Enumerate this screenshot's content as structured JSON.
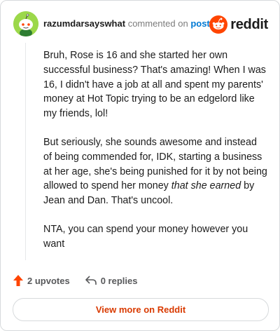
{
  "header": {
    "username": "razumdarsayswhat",
    "commented_text": "commented on",
    "post_link": "post",
    "logo_text": "reddit"
  },
  "comment": {
    "p1": "Bruh, Rose is 16 and she started her own successful business? That's amazing! When I was 16, I didn't have a job at all and spent my parents' money at Hot Topic trying to be an edgelord like my friends, lol!",
    "p2_a": "But seriously, she sounds awesome and instead of being commended for, IDK, starting a business at her age, she's being punished for it by not being allowed to spend her money ",
    "p2_em1": "that she earned",
    "p2_b": " by Jean and Dan. That's uncool.",
    "p3": "NTA, you can spend your money however you want"
  },
  "actions": {
    "upvotes": "2 upvotes",
    "replies": "0 replies"
  },
  "cta": {
    "label": "View more on Reddit"
  },
  "colors": {
    "accent": "#d93a00",
    "upvote": "#ff4500",
    "link": "#0079d3",
    "avatar_bg": "#9cd84a"
  },
  "icons": [
    "snoo-avatar-icon",
    "reddit-logo-icon",
    "upvote-arrow-icon",
    "reply-arrow-icon"
  ]
}
